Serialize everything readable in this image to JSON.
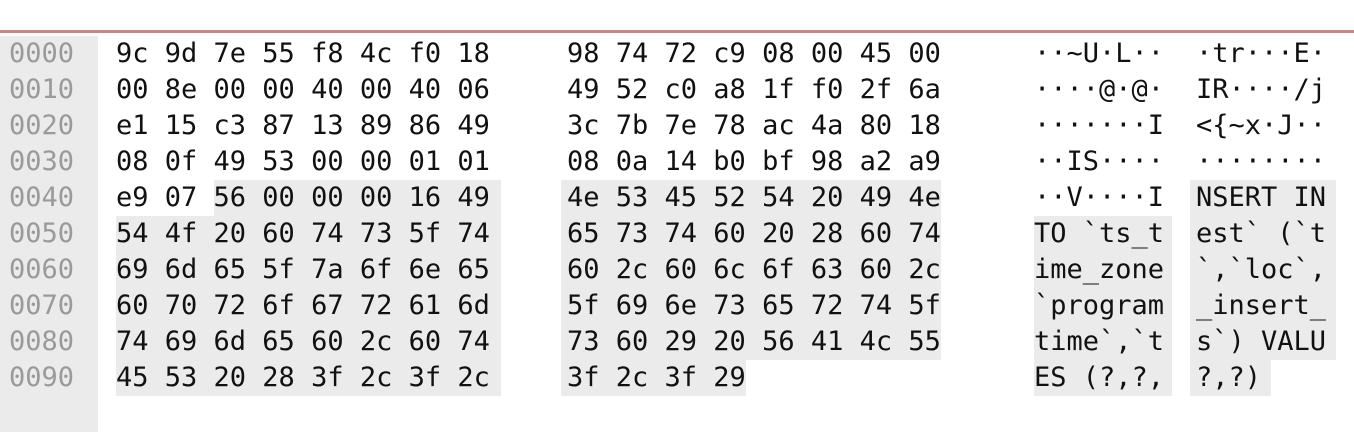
{
  "hex_view": {
    "rows": [
      {
        "offset": "0000",
        "hex1": "9c 9d 7e 55 f8 4c f0 18",
        "hex2": "98 74 72 c9 08 00 45 00",
        "ascii1": "··~U·L··",
        "ascii2": "·tr···E·"
      },
      {
        "offset": "0010",
        "hex1": "00 8e 00 00 40 00 40 06",
        "hex2": "49 52 c0 a8 1f f0 2f 6a",
        "ascii1": "····@·@·",
        "ascii2": "IR····/j"
      },
      {
        "offset": "0020",
        "hex1": "e1 15 c3 87 13 89 86 49",
        "hex2": "3c 7b 7e 78 ac 4a 80 18",
        "ascii1": "·······I",
        "ascii2": "<{~x·J··"
      },
      {
        "offset": "0030",
        "hex1": "08 0f 49 53 00 00 01 01",
        "hex2": "08 0a 14 b0 bf 98 a2 a9",
        "ascii1": "··IS····",
        "ascii2": "········"
      },
      {
        "offset": "0040",
        "hex1": "e9 07 56 00 00 00 16 49",
        "hex2": "4e 53 45 52 54 20 49 4e",
        "ascii1": "··V····I",
        "ascii2": "NSERT IN"
      },
      {
        "offset": "0050",
        "hex1": "54 4f 20 60 74 73 5f 74",
        "hex2": "65 73 74 60 20 28 60 74",
        "ascii1": "TO `ts_t",
        "ascii2": "est` (`t"
      },
      {
        "offset": "0060",
        "hex1": "69 6d 65 5f 7a 6f 6e 65",
        "hex2": "60 2c 60 6c 6f 63 60 2c",
        "ascii1": "ime_zone",
        "ascii2": "`,`loc`,"
      },
      {
        "offset": "0070",
        "hex1": "60 70 72 6f 67 72 61 6d",
        "hex2": "5f 69 6e 73 65 72 74 5f",
        "ascii1": "`program",
        "ascii2": "_insert_"
      },
      {
        "offset": "0080",
        "hex1": "74 69 6d 65 60 2c 60 74",
        "hex2": "73 60 29 20 56 41 4c 55",
        "ascii1": "time`,`t",
        "ascii2": "s`) VALU"
      },
      {
        "offset": "0090",
        "hex1": "45 53 20 28 3f 2c 3f 2c",
        "hex2": "3f 2c 3f 29",
        "ascii1": "ES (?,?,",
        "ascii2": "?,?)"
      }
    ]
  },
  "colors": {
    "highlight": "#ebebeb",
    "offset_text": "#9a9a9a",
    "top_rule": "#c98585"
  }
}
